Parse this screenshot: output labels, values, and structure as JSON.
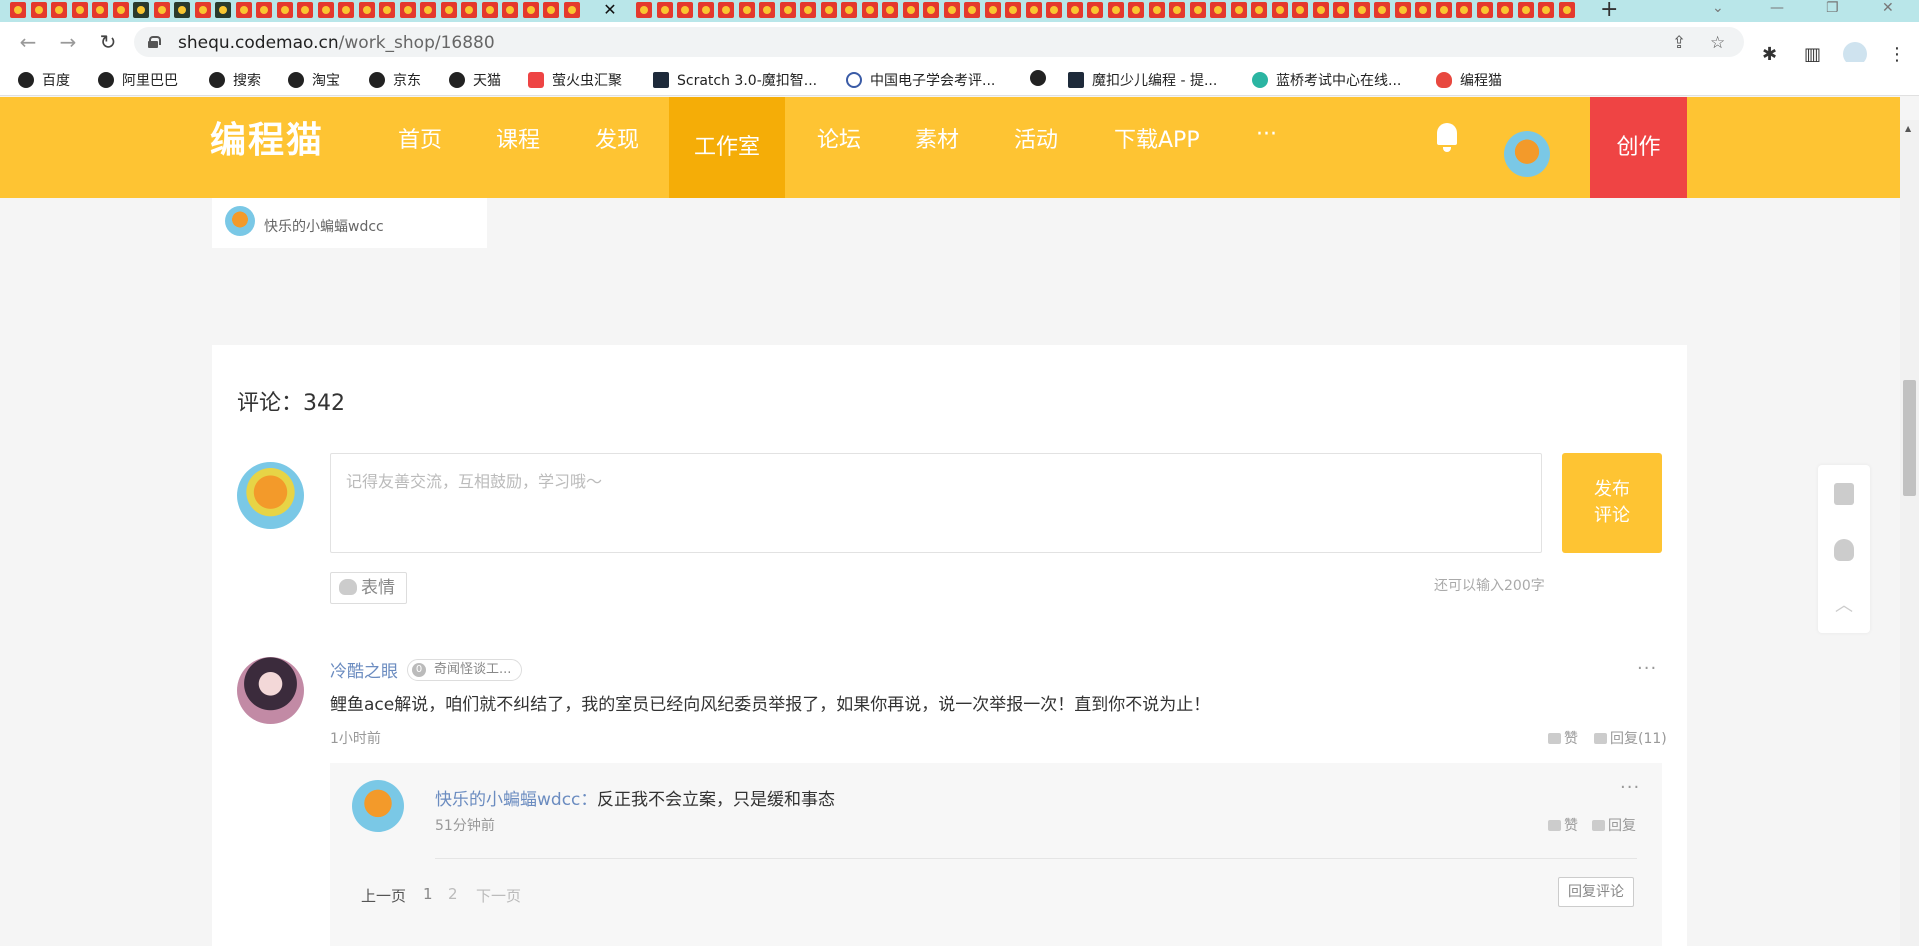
{
  "browser": {
    "url_host": "shequ.codemao.cn",
    "url_path": "/work_shop/16880",
    "tab_close": "✕",
    "new_tab": "+",
    "bookmarks": [
      {
        "label": "百度"
      },
      {
        "label": "阿里巴巴"
      },
      {
        "label": "搜索"
      },
      {
        "label": "淘宝"
      },
      {
        "label": "京东"
      },
      {
        "label": "天猫"
      },
      {
        "label": "萤火虫汇聚"
      },
      {
        "label": "Scratch 3.0-魔扣智..."
      },
      {
        "label": "中国电子学会考评..."
      },
      {
        "label": ""
      },
      {
        "label": "魔扣少儿编程 - 提..."
      },
      {
        "label": "蓝桥考试中心在线..."
      },
      {
        "label": "编程猫"
      }
    ]
  },
  "header": {
    "logo": "编程猫",
    "nav": [
      "首页",
      "课程",
      "发现",
      "工作室",
      "论坛",
      "素材",
      "活动",
      "下载APP",
      "···"
    ],
    "active_nav": "工作室",
    "create_label": "创作"
  },
  "author_card": {
    "name": "快乐的小蝙蝠wdcc"
  },
  "comments": {
    "title": "评论：342",
    "placeholder": "记得友善交流，互相鼓励，学习哦～",
    "post_button_line1": "发布",
    "post_button_line2": "评论",
    "emoji_label": "表情",
    "remaining": "还可以输入200字",
    "items": [
      {
        "user": "冷酷之眼",
        "badge_level": "0",
        "badge_text": "奇闻怪谈工...",
        "text": "鲤鱼ace解说，咱们就不纠结了，我的室员已经向风纪委员举报了，如果你再说，说一次举报一次！直到你不说为止！",
        "time": "1小时前",
        "like_label": "赞",
        "reply_label": "回复(11)",
        "replies": [
          {
            "user": "快乐的小蝙蝠wdcc",
            "separator": "：",
            "text": "反正我不会立案，只是缓和事态",
            "time": "51分钟前",
            "like_label": "赞",
            "reply_label": "回复"
          }
        ],
        "pager": {
          "prev": "上一页",
          "pages": [
            "1",
            "2"
          ],
          "next": "下一页"
        },
        "reply_comment_button": "回复评论"
      }
    ]
  },
  "colors": {
    "brand_yellow": "#fec433",
    "active_nav": "#f5ad07",
    "create_red": "#ef4444",
    "link_blue": "#6b8cc0"
  }
}
